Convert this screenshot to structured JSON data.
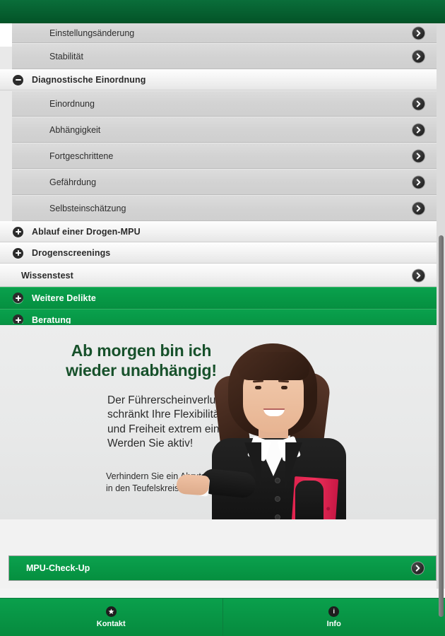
{
  "topbar": {
    "title": ""
  },
  "accordion": {
    "visible_subitems_top": [
      {
        "label": "Einstellungsänderung",
        "chevron": "chevron-right-icon"
      },
      {
        "label": "Stabilität",
        "chevron": "chevron-right-icon"
      }
    ],
    "groups": [
      {
        "label": "Diagnostische Einordnung",
        "state": "expanded",
        "icon": "minus-circle-icon",
        "style": "grey",
        "items": [
          {
            "label": "Einordnung",
            "chevron": "chevron-right-icon"
          },
          {
            "label": "Abhängigkeit",
            "chevron": "chevron-right-icon"
          },
          {
            "label": "Fortgeschrittene",
            "chevron": "chevron-right-icon"
          },
          {
            "label": "Gefährdung",
            "chevron": "chevron-right-icon"
          },
          {
            "label": "Selbsteinschätzung",
            "chevron": "chevron-right-icon"
          }
        ]
      },
      {
        "label": "Ablauf einer Drogen-MPU",
        "state": "collapsed",
        "icon": "plus-circle-icon",
        "style": "grey",
        "items": []
      },
      {
        "label": "Drogenscreenings",
        "state": "collapsed",
        "icon": "plus-circle-icon",
        "style": "grey",
        "items": []
      },
      {
        "label": "Wissenstest",
        "state": "link",
        "icon": "none",
        "style": "grey",
        "chevron": "chevron-right-icon",
        "items": []
      },
      {
        "label": "Weitere Delikte",
        "state": "collapsed",
        "icon": "plus-circle-icon",
        "style": "green",
        "items": []
      },
      {
        "label": "Beratung",
        "state": "collapsed",
        "icon": "plus-circle-icon",
        "style": "green",
        "items": []
      }
    ]
  },
  "banner": {
    "headline_line1": "Ab morgen bin ich",
    "headline_line2": "wieder unabhängig!",
    "body_line1": "Der Führerscheinverlust",
    "body_line2": "schränkt Ihre Flexibilität",
    "body_line3": "und Freiheit extrem ein.",
    "body_line4": "Werden Sie aktiv!",
    "footer_line1": "Verhindern Sie ein Abrutschen",
    "footer_line2": "in den Teufelskreis MPU!",
    "image_alt": "businesswoman-holding-red-folder",
    "headline_color": "#17512b"
  },
  "cta": {
    "label": "MPU-Check-Up",
    "chevron": "chevron-right-icon",
    "color": "#0aa14e"
  },
  "bottom_nav": [
    {
      "label": "Kontakt",
      "icon": "star-icon"
    },
    {
      "label": "Info",
      "icon": "info-icon"
    }
  ],
  "theme": {
    "green": "#0aa14e",
    "dark_green": "#06572b",
    "grey_row": "#d4d4d4"
  }
}
